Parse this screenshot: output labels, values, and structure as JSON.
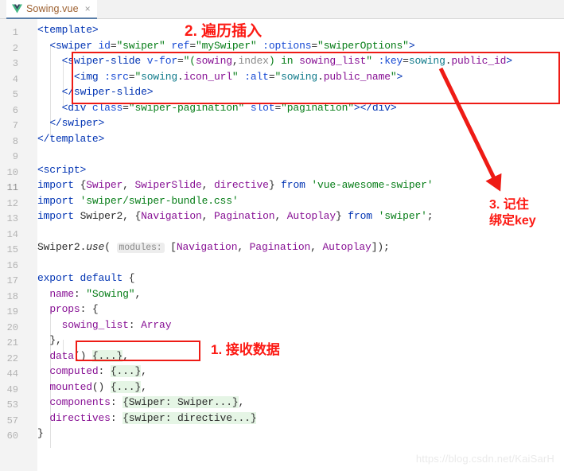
{
  "window": {
    "tab": {
      "label": "Sowing.vue",
      "icon": "vue-logo-icon",
      "close_label": "×"
    }
  },
  "editor": {
    "line_numbers": [
      "1",
      "2",
      "3",
      "4",
      "5",
      "6",
      "7",
      "8",
      "9",
      "10",
      "11",
      "12",
      "13",
      "14",
      "15",
      "16",
      "17",
      "18",
      "19",
      "20",
      "21",
      "22",
      "44",
      "49",
      "53",
      "57",
      "60"
    ],
    "current_line": "11",
    "lines": [
      {
        "n": "1",
        "text": "<template>"
      },
      {
        "n": "2",
        "text": "  <swiper id=\"swiper\" ref=\"mySwiper\" :options=\"swiperOptions\">"
      },
      {
        "n": "3",
        "text": "    <swiper-slide v-for=\"(sowing,index) in sowing_list\" :key=sowing.public_id>"
      },
      {
        "n": "4",
        "text": "      <img :src=\"sowing.icon_url\" :alt=\"sowing.public_name\">"
      },
      {
        "n": "5",
        "text": "    </swiper-slide>"
      },
      {
        "n": "6",
        "text": "    <div class=\"swiper-pagination\" slot=\"pagination\"></div>"
      },
      {
        "n": "7",
        "text": "  </swiper>"
      },
      {
        "n": "8",
        "text": "</template>"
      },
      {
        "n": "9",
        "text": ""
      },
      {
        "n": "10",
        "text": "<script>"
      },
      {
        "n": "11",
        "text": "import {Swiper, SwiperSlide, directive} from 'vue-awesome-swiper'"
      },
      {
        "n": "12",
        "text": "import 'swiper/swiper-bundle.css'"
      },
      {
        "n": "13",
        "text": "import Swiper2, {Navigation, Pagination, Autoplay} from 'swiper';"
      },
      {
        "n": "14",
        "text": ""
      },
      {
        "n": "15",
        "text": "Swiper2.use( modules: [Navigation, Pagination, Autoplay]);"
      },
      {
        "n": "16",
        "text": ""
      },
      {
        "n": "17",
        "text": "export default {"
      },
      {
        "n": "18",
        "text": "  name: \"Sowing\","
      },
      {
        "n": "19",
        "text": "  props: {"
      },
      {
        "n": "20",
        "text": "    sowing_list: Array"
      },
      {
        "n": "21",
        "text": "  },"
      },
      {
        "n": "22",
        "text": "  data() {...},"
      },
      {
        "n": "44",
        "text": "  computed: {...},"
      },
      {
        "n": "49",
        "text": "  mounted() {...},"
      },
      {
        "n": "53",
        "text": "  components: {Swiper: Swiper...},"
      },
      {
        "n": "57",
        "text": "  directives: {swiper: directive...}"
      },
      {
        "n": "60",
        "text": "}"
      }
    ],
    "inlay_hint": "modules:"
  },
  "annotations": [
    {
      "id": "1",
      "text": "1. 接收数据"
    },
    {
      "id": "2",
      "text": "2. 遍历插入"
    },
    {
      "id": "3",
      "line1": "3. 记住",
      "line2": "绑定key"
    }
  ],
  "watermark": "https://blog.csdn.net/KaiSarH",
  "colors": {
    "annotation_red": "#fc1a14",
    "box_red": "#ee1b15",
    "tab_label": "#9c5f2e",
    "current_line_bg": "#fdfbe8",
    "gutter_bg": "#f3f3f3"
  }
}
